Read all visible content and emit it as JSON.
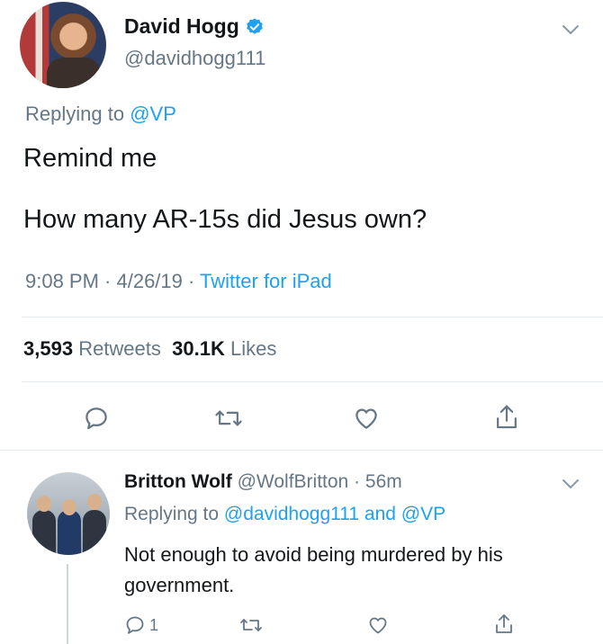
{
  "main_tweet": {
    "display_name": "David Hogg",
    "handle": "@davidhogg111",
    "replying_prefix": "Replying to ",
    "replying_to": "@VP",
    "text_line_1": "Remind me",
    "text_line_2": "How many AR-15s did Jesus own?",
    "time": "9:08 PM · 4/26/19 · ",
    "source": "Twitter for iPad",
    "retweets_count": "3,593",
    "retweets_label": "Retweets",
    "likes_count": "30.1K",
    "likes_label": "Likes"
  },
  "reply_tweet": {
    "display_name": "Britton Wolf",
    "handle_time": "@WolfBritton · 56m",
    "replying_prefix": "Replying to ",
    "replying_to": "@davidhogg111 and @VP",
    "text": "Not enough to avoid being murdered by his government.",
    "reply_count": "1"
  },
  "icons": [
    "verified-badge-icon",
    "chevron-down-icon",
    "reply-icon",
    "retweet-icon",
    "like-icon",
    "share-icon"
  ],
  "colors": {
    "accent": "#1da1f2",
    "secondary_text": "#657786",
    "primary_text": "#14171a",
    "divider": "#e6ecf0"
  }
}
